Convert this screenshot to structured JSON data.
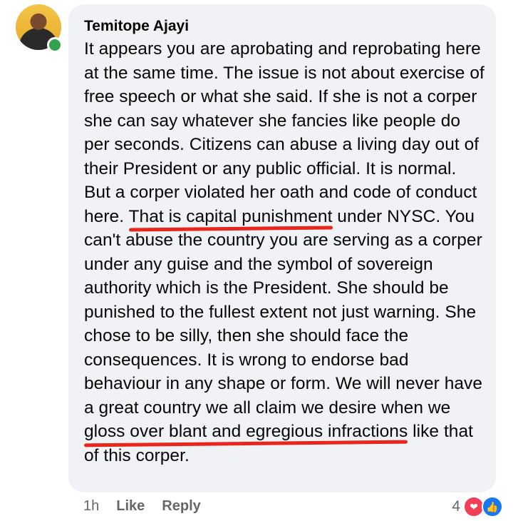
{
  "comment": {
    "author": "Temitope Ajayi",
    "text_parts": [
      "It appears you are aprobating and reprobating here at the same time. The issue is not about exercise of free speech or what she said. If she is not a corper she can say whatever she fancies like people do per seconds. Citizens can abuse a living day out of their President or any public official. It is normal. But a corper violated her oath and code of conduct here. ",
      "That is capital punishment",
      " under NYSC. You can't abuse the country you are serving as a corper under any guise and the symbol of sovereign authority which is the President. She should be punished to the fullest extent not just warning. She chose to be silly, then she should face the consequences. It is wrong to endorse bad behaviour in any shape or form. We will never have a great country we all claim we desire when we ",
      "gloss over blant and egregious infractions",
      " like that of this corper."
    ]
  },
  "actions": {
    "time": "1h",
    "like": "Like",
    "reply": "Reply"
  },
  "reactions": {
    "count": "4",
    "icons": [
      "love-icon",
      "like-icon"
    ]
  },
  "colors": {
    "bubble": "#f0f2f5",
    "underline": "#e8261b",
    "presence": "#31a24c"
  }
}
